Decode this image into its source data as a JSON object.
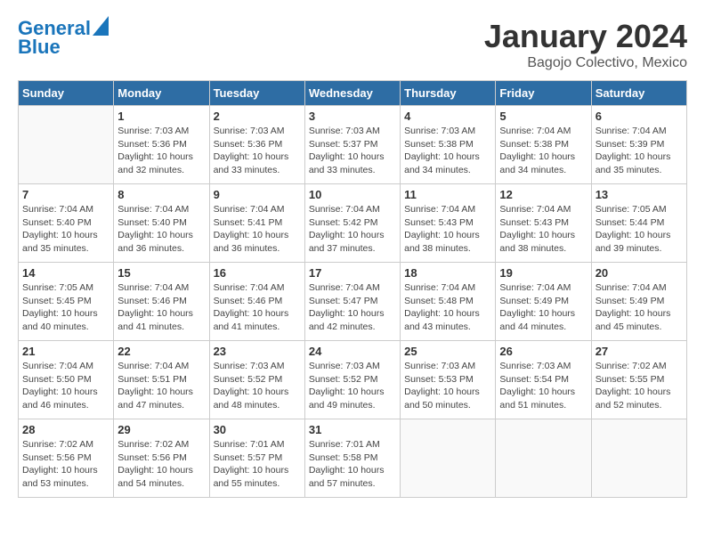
{
  "header": {
    "logo_line1": "General",
    "logo_line2": "Blue",
    "month_title": "January 2024",
    "subtitle": "Bagojo Colectivo, Mexico"
  },
  "weekdays": [
    "Sunday",
    "Monday",
    "Tuesday",
    "Wednesday",
    "Thursday",
    "Friday",
    "Saturday"
  ],
  "weeks": [
    [
      {
        "day": "",
        "info": ""
      },
      {
        "day": "1",
        "info": "Sunrise: 7:03 AM\nSunset: 5:36 PM\nDaylight: 10 hours\nand 32 minutes."
      },
      {
        "day": "2",
        "info": "Sunrise: 7:03 AM\nSunset: 5:36 PM\nDaylight: 10 hours\nand 33 minutes."
      },
      {
        "day": "3",
        "info": "Sunrise: 7:03 AM\nSunset: 5:37 PM\nDaylight: 10 hours\nand 33 minutes."
      },
      {
        "day": "4",
        "info": "Sunrise: 7:03 AM\nSunset: 5:38 PM\nDaylight: 10 hours\nand 34 minutes."
      },
      {
        "day": "5",
        "info": "Sunrise: 7:04 AM\nSunset: 5:38 PM\nDaylight: 10 hours\nand 34 minutes."
      },
      {
        "day": "6",
        "info": "Sunrise: 7:04 AM\nSunset: 5:39 PM\nDaylight: 10 hours\nand 35 minutes."
      }
    ],
    [
      {
        "day": "7",
        "info": "Sunrise: 7:04 AM\nSunset: 5:40 PM\nDaylight: 10 hours\nand 35 minutes."
      },
      {
        "day": "8",
        "info": "Sunrise: 7:04 AM\nSunset: 5:40 PM\nDaylight: 10 hours\nand 36 minutes."
      },
      {
        "day": "9",
        "info": "Sunrise: 7:04 AM\nSunset: 5:41 PM\nDaylight: 10 hours\nand 36 minutes."
      },
      {
        "day": "10",
        "info": "Sunrise: 7:04 AM\nSunset: 5:42 PM\nDaylight: 10 hours\nand 37 minutes."
      },
      {
        "day": "11",
        "info": "Sunrise: 7:04 AM\nSunset: 5:43 PM\nDaylight: 10 hours\nand 38 minutes."
      },
      {
        "day": "12",
        "info": "Sunrise: 7:04 AM\nSunset: 5:43 PM\nDaylight: 10 hours\nand 38 minutes."
      },
      {
        "day": "13",
        "info": "Sunrise: 7:05 AM\nSunset: 5:44 PM\nDaylight: 10 hours\nand 39 minutes."
      }
    ],
    [
      {
        "day": "14",
        "info": "Sunrise: 7:05 AM\nSunset: 5:45 PM\nDaylight: 10 hours\nand 40 minutes."
      },
      {
        "day": "15",
        "info": "Sunrise: 7:04 AM\nSunset: 5:46 PM\nDaylight: 10 hours\nand 41 minutes."
      },
      {
        "day": "16",
        "info": "Sunrise: 7:04 AM\nSunset: 5:46 PM\nDaylight: 10 hours\nand 41 minutes."
      },
      {
        "day": "17",
        "info": "Sunrise: 7:04 AM\nSunset: 5:47 PM\nDaylight: 10 hours\nand 42 minutes."
      },
      {
        "day": "18",
        "info": "Sunrise: 7:04 AM\nSunset: 5:48 PM\nDaylight: 10 hours\nand 43 minutes."
      },
      {
        "day": "19",
        "info": "Sunrise: 7:04 AM\nSunset: 5:49 PM\nDaylight: 10 hours\nand 44 minutes."
      },
      {
        "day": "20",
        "info": "Sunrise: 7:04 AM\nSunset: 5:49 PM\nDaylight: 10 hours\nand 45 minutes."
      }
    ],
    [
      {
        "day": "21",
        "info": "Sunrise: 7:04 AM\nSunset: 5:50 PM\nDaylight: 10 hours\nand 46 minutes."
      },
      {
        "day": "22",
        "info": "Sunrise: 7:04 AM\nSunset: 5:51 PM\nDaylight: 10 hours\nand 47 minutes."
      },
      {
        "day": "23",
        "info": "Sunrise: 7:03 AM\nSunset: 5:52 PM\nDaylight: 10 hours\nand 48 minutes."
      },
      {
        "day": "24",
        "info": "Sunrise: 7:03 AM\nSunset: 5:52 PM\nDaylight: 10 hours\nand 49 minutes."
      },
      {
        "day": "25",
        "info": "Sunrise: 7:03 AM\nSunset: 5:53 PM\nDaylight: 10 hours\nand 50 minutes."
      },
      {
        "day": "26",
        "info": "Sunrise: 7:03 AM\nSunset: 5:54 PM\nDaylight: 10 hours\nand 51 minutes."
      },
      {
        "day": "27",
        "info": "Sunrise: 7:02 AM\nSunset: 5:55 PM\nDaylight: 10 hours\nand 52 minutes."
      }
    ],
    [
      {
        "day": "28",
        "info": "Sunrise: 7:02 AM\nSunset: 5:56 PM\nDaylight: 10 hours\nand 53 minutes."
      },
      {
        "day": "29",
        "info": "Sunrise: 7:02 AM\nSunset: 5:56 PM\nDaylight: 10 hours\nand 54 minutes."
      },
      {
        "day": "30",
        "info": "Sunrise: 7:01 AM\nSunset: 5:57 PM\nDaylight: 10 hours\nand 55 minutes."
      },
      {
        "day": "31",
        "info": "Sunrise: 7:01 AM\nSunset: 5:58 PM\nDaylight: 10 hours\nand 57 minutes."
      },
      {
        "day": "",
        "info": ""
      },
      {
        "day": "",
        "info": ""
      },
      {
        "day": "",
        "info": ""
      }
    ]
  ]
}
